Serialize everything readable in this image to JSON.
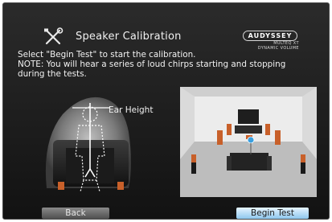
{
  "header": {
    "icon": "tools-icon",
    "title": "Speaker Calibration"
  },
  "brand": {
    "logo_text": "AUDYSSEY",
    "line1": "MULTEQ XT",
    "line2": "DYNAMIC VOLUME"
  },
  "instructions": {
    "line1": "Select \"Begin Test\" to start the calibration.",
    "line2": "NOTE: You will hear a series of loud chirps starting and stopping",
    "line3": "during the tests."
  },
  "illustration": {
    "ear_height_label": "Ear Height"
  },
  "buttons": {
    "back_label": "Back",
    "begin_label": "Begin Test"
  },
  "colors": {
    "background": "#1a1a1a",
    "begin_button": "#9fd0f2",
    "back_button": "#6b6b6b",
    "speaker": "#c8602a"
  }
}
